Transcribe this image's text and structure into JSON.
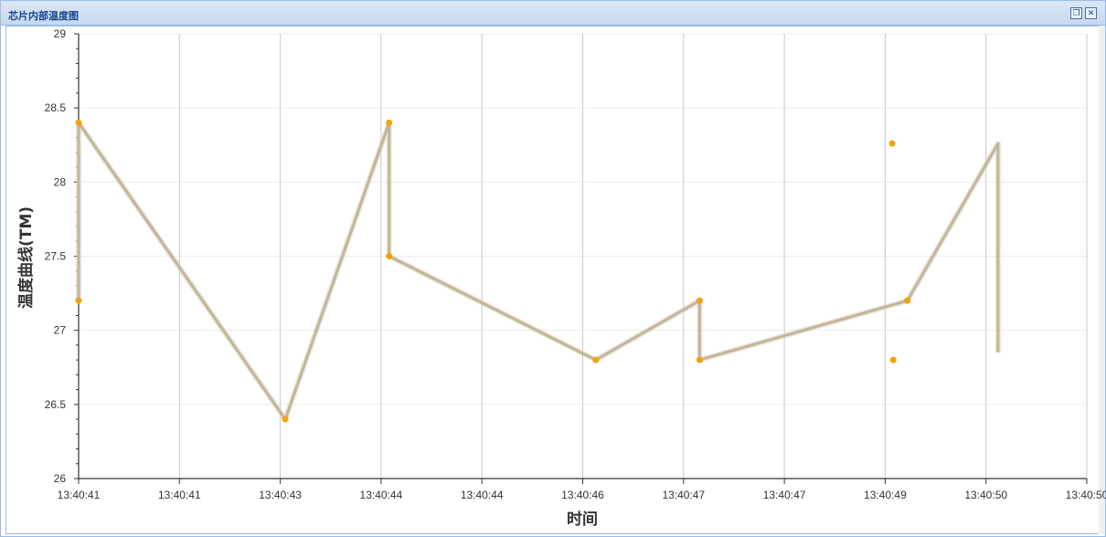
{
  "window": {
    "title": "芯片内部温度图",
    "restore_icon": "restore-icon",
    "close_icon": "close-icon"
  },
  "chart_data": {
    "type": "line",
    "title": "",
    "xlabel": "时间",
    "ylabel": "温度曲线(TM)",
    "ylim": [
      26,
      29
    ],
    "y_ticks": [
      "26",
      "26.5",
      "27",
      "27.5",
      "28",
      "28.5",
      "29"
    ],
    "x_ticks": [
      "13:40:41",
      "13:40:41",
      "13:40:43",
      "13:40:44",
      "13:40:44",
      "13:40:46",
      "13:40:47",
      "13:40:47",
      "13:40:49",
      "13:40:50",
      "13:40:50"
    ],
    "grid": true,
    "line_color": "#c2b59a",
    "marker_color": "#f0a30a",
    "series": [
      {
        "values": [
          {
            "x": 0.0,
            "y": 27.2
          },
          {
            "x": 0.0,
            "y": 28.4
          },
          {
            "x": 2.05,
            "y": 26.4
          },
          {
            "x": 3.08,
            "y": 28.4
          },
          {
            "x": 3.08,
            "y": 27.5
          },
          {
            "x": 5.13,
            "y": 26.8
          },
          {
            "x": 6.16,
            "y": 27.2
          },
          {
            "x": 6.16,
            "y": 26.8
          },
          {
            "x": 8.07,
            "y": 28.26
          },
          {
            "x": 8.08,
            "y": 26.8
          },
          {
            "x": 8.22,
            "y": 27.2
          },
          {
            "x": 9.12,
            "y": 28.26
          },
          {
            "x": 9.12,
            "y": 26.85
          }
        ]
      }
    ]
  }
}
